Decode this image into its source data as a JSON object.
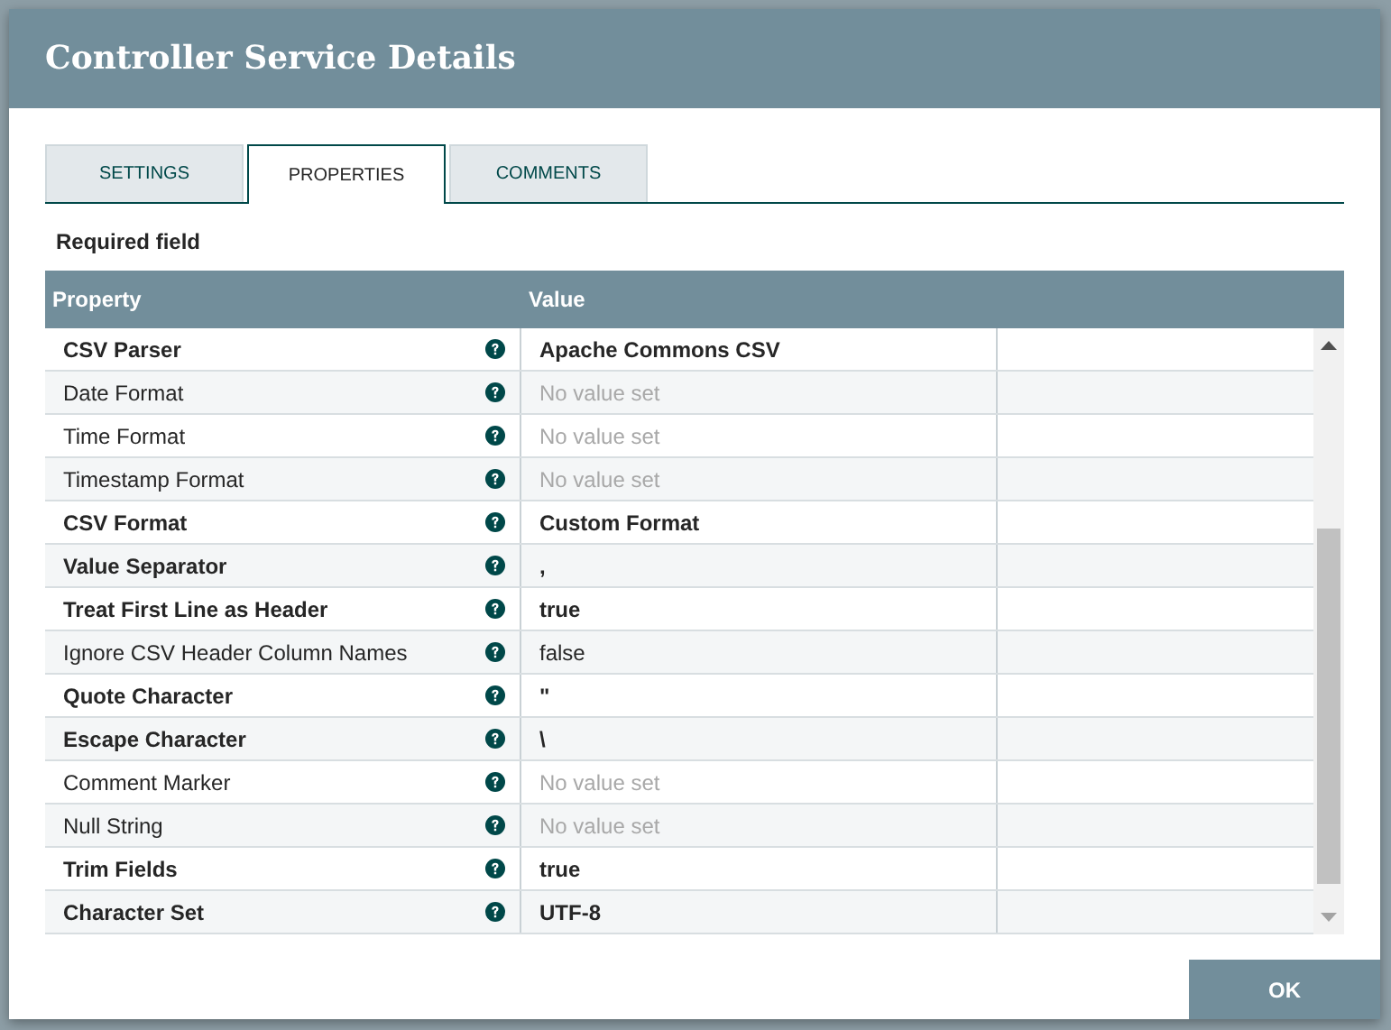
{
  "dialog": {
    "title": "Controller Service Details"
  },
  "tabs": [
    {
      "label": "SETTINGS",
      "selected": false
    },
    {
      "label": "PROPERTIES",
      "selected": true
    },
    {
      "label": "COMMENTS",
      "selected": false
    }
  ],
  "required_note": "Required field",
  "table": {
    "columns": [
      "Property",
      "Value"
    ],
    "rows": [
      {
        "name": "CSV Parser",
        "required": true,
        "value": "Apache Commons CSV",
        "unset": false
      },
      {
        "name": "Date Format",
        "required": false,
        "value": "No value set",
        "unset": true
      },
      {
        "name": "Time Format",
        "required": false,
        "value": "No value set",
        "unset": true
      },
      {
        "name": "Timestamp Format",
        "required": false,
        "value": "No value set",
        "unset": true
      },
      {
        "name": "CSV Format",
        "required": true,
        "value": "Custom Format",
        "unset": false
      },
      {
        "name": "Value Separator",
        "required": true,
        "value": ",",
        "unset": false
      },
      {
        "name": "Treat First Line as Header",
        "required": true,
        "value": "true",
        "unset": false
      },
      {
        "name": "Ignore CSV Header Column Names",
        "required": false,
        "value": "false",
        "unset": false
      },
      {
        "name": "Quote Character",
        "required": true,
        "value": "\"",
        "unset": false
      },
      {
        "name": "Escape Character",
        "required": true,
        "value": "\\",
        "unset": false
      },
      {
        "name": "Comment Marker",
        "required": false,
        "value": "No value set",
        "unset": true
      },
      {
        "name": "Null String",
        "required": false,
        "value": "No value set",
        "unset": true
      },
      {
        "name": "Trim Fields",
        "required": true,
        "value": "true",
        "unset": false
      },
      {
        "name": "Character Set",
        "required": true,
        "value": "UTF-8",
        "unset": false
      }
    ]
  },
  "buttons": [
    {
      "label": "OK"
    }
  ]
}
